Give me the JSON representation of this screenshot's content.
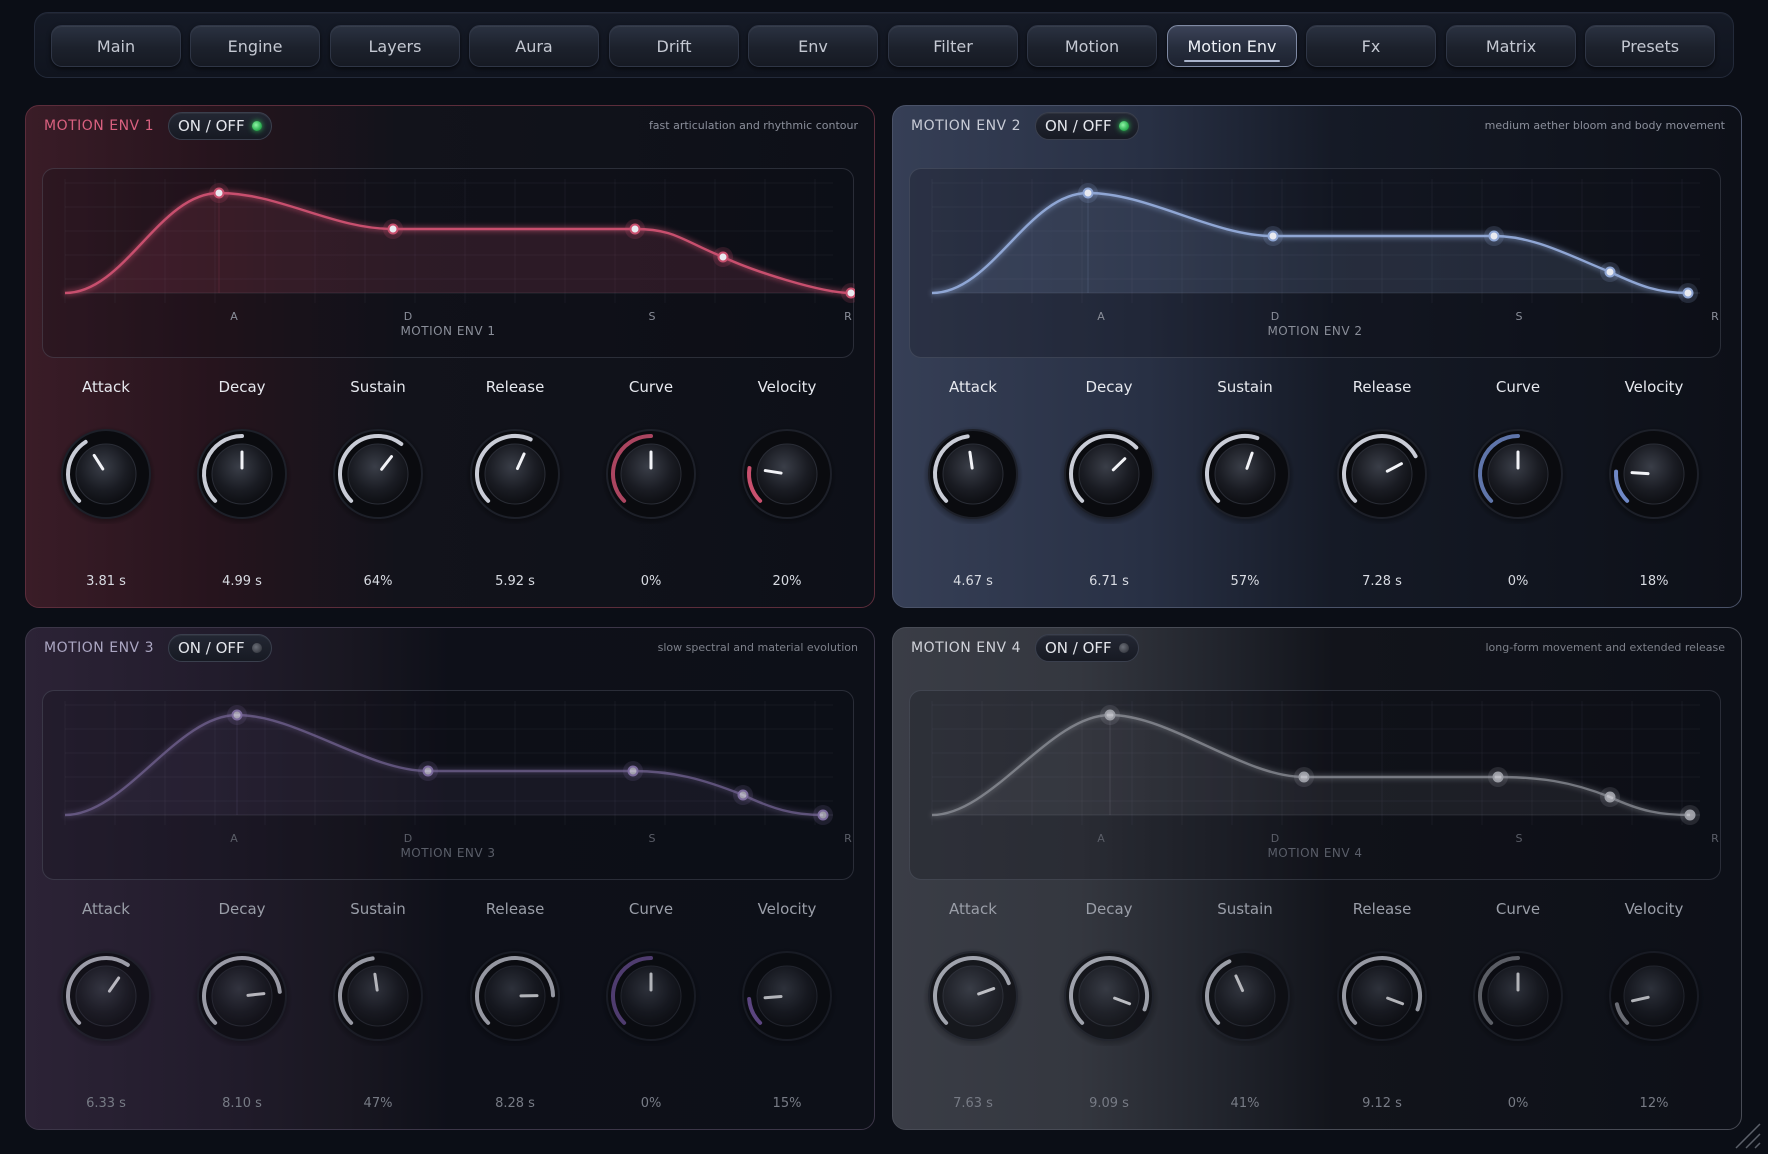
{
  "tabs": [
    {
      "label": "Main",
      "active": false
    },
    {
      "label": "Engine",
      "active": false
    },
    {
      "label": "Layers",
      "active": false
    },
    {
      "label": "Aura",
      "active": false
    },
    {
      "label": "Drift",
      "active": false
    },
    {
      "label": "Env",
      "active": false
    },
    {
      "label": "Filter",
      "active": false
    },
    {
      "label": "Motion",
      "active": false
    },
    {
      "label": "Motion Env",
      "active": true
    },
    {
      "label": "Fx",
      "active": false
    },
    {
      "label": "Matrix",
      "active": false
    },
    {
      "label": "Presets",
      "active": false
    }
  ],
  "toggle_label": "ON / OFF",
  "knob_labels": [
    "Attack",
    "Decay",
    "Sustain",
    "Release",
    "Curve",
    "Velocity"
  ],
  "stage_markers": [
    "A",
    "D",
    "S",
    "R"
  ],
  "panels": [
    {
      "title": "MOTION ENV 1",
      "description": "fast articulation and rhythmic contour",
      "graph_label": "MOTION ENV 1",
      "enabled": true,
      "accent": "#c8506e",
      "knobs": [
        {
          "value": "3.81 s",
          "fraction": 0.38
        },
        {
          "value": "4.99 s",
          "fraction": 0.5
        },
        {
          "value": "64%",
          "fraction": 0.64
        },
        {
          "value": "5.92 s",
          "fraction": 0.59
        },
        {
          "value": "0%",
          "fraction": 0.5,
          "bipolar": true
        },
        {
          "value": "20%",
          "fraction": 0.2
        }
      ]
    },
    {
      "title": "MOTION ENV 2",
      "description": "medium aether bloom and body movement",
      "graph_label": "MOTION ENV 2",
      "enabled": true,
      "accent": "#8fa6d4",
      "knobs": [
        {
          "value": "4.67 s",
          "fraction": 0.47
        },
        {
          "value": "6.71 s",
          "fraction": 0.67
        },
        {
          "value": "57%",
          "fraction": 0.57
        },
        {
          "value": "7.28 s",
          "fraction": 0.73
        },
        {
          "value": "0%",
          "fraction": 0.5,
          "bipolar": true
        },
        {
          "value": "18%",
          "fraction": 0.18
        }
      ]
    },
    {
      "title": "MOTION ENV 3",
      "description": "slow spectral and material evolution",
      "graph_label": "MOTION ENV 3",
      "enabled": false,
      "accent": "#7b6a9c",
      "knobs": [
        {
          "value": "6.33 s",
          "fraction": 0.63
        },
        {
          "value": "8.10 s",
          "fraction": 0.81
        },
        {
          "value": "47%",
          "fraction": 0.47
        },
        {
          "value": "8.28 s",
          "fraction": 0.83
        },
        {
          "value": "0%",
          "fraction": 0.5,
          "bipolar": true
        },
        {
          "value": "15%",
          "fraction": 0.15
        }
      ]
    },
    {
      "title": "MOTION ENV 4",
      "description": "long-form movement and extended release",
      "graph_label": "MOTION ENV 4",
      "enabled": false,
      "accent": "#9a9ca4",
      "knobs": [
        {
          "value": "7.63 s",
          "fraction": 0.76
        },
        {
          "value": "9.09 s",
          "fraction": 0.91
        },
        {
          "value": "41%",
          "fraction": 0.41
        },
        {
          "value": "9.12 s",
          "fraction": 0.91
        },
        {
          "value": "0%",
          "fraction": 0.5,
          "bipolar": true
        },
        {
          "value": "12%",
          "fraction": 0.12
        }
      ]
    }
  ]
}
